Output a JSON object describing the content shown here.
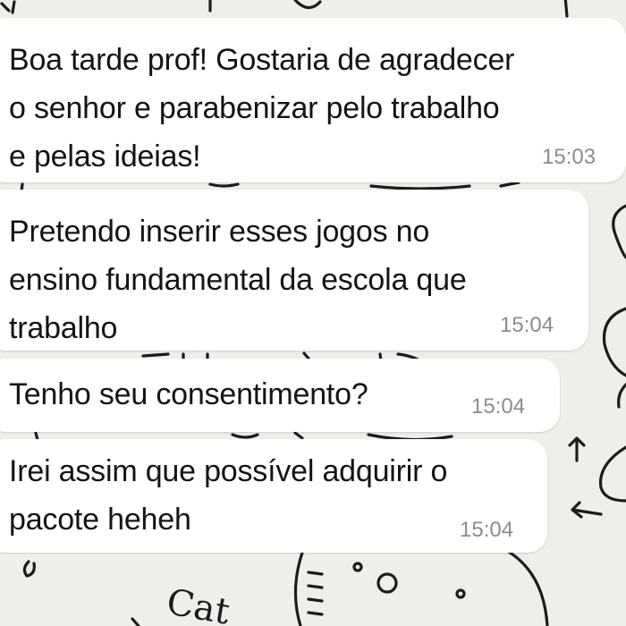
{
  "chat": {
    "messages": [
      {
        "text": "Boa tarde prof! Gostaria de agradecer\no senhor e parabenizar pelo trabalho\ne pelas ideias!",
        "time": "15:03"
      },
      {
        "text": "Pretendo inserir esses jogos no\nensino fundamental da escola que\ntrabalho",
        "time": "15:04"
      },
      {
        "text": "Tenho seu consentimento?",
        "time": "15:04"
      },
      {
        "text": "Irei assim que possível adquirir o\npacote heheh",
        "time": "15:04"
      }
    ]
  },
  "wallpaper": {
    "doodle_text": "Cat"
  }
}
